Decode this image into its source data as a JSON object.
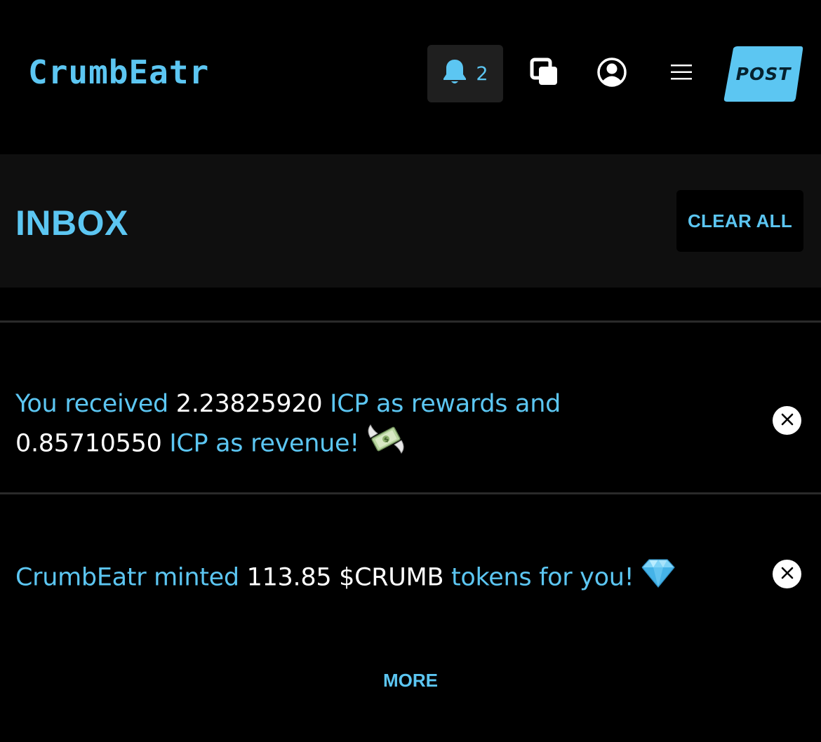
{
  "header": {
    "logo_text": "CrumbEatr",
    "notification_count": "2",
    "post_label": "POST",
    "icons": [
      "bell-icon",
      "windows-icon",
      "user-icon",
      "menu-icon"
    ]
  },
  "inbox": {
    "title": "INBOX",
    "clear_all_label": "CLEAR ALL"
  },
  "notifications": [
    {
      "part1": "You received ",
      "amount1": "2.23825920",
      "part2": " ICP as rewards and ",
      "amount2": "0.85710550",
      "part3": " ICP as revenue!",
      "emoji": "money-with-wings-icon"
    },
    {
      "part1": "CrumbEatr minted ",
      "amount1": "113.85 $CRUMB",
      "part2": " tokens for you!",
      "emoji": "gem-icon"
    }
  ],
  "more_label": "MORE",
  "colors": {
    "accent": "#5cc6f2",
    "background": "#000000",
    "panel": "#0f0f0f",
    "button_bg": "#1f1f1f"
  }
}
